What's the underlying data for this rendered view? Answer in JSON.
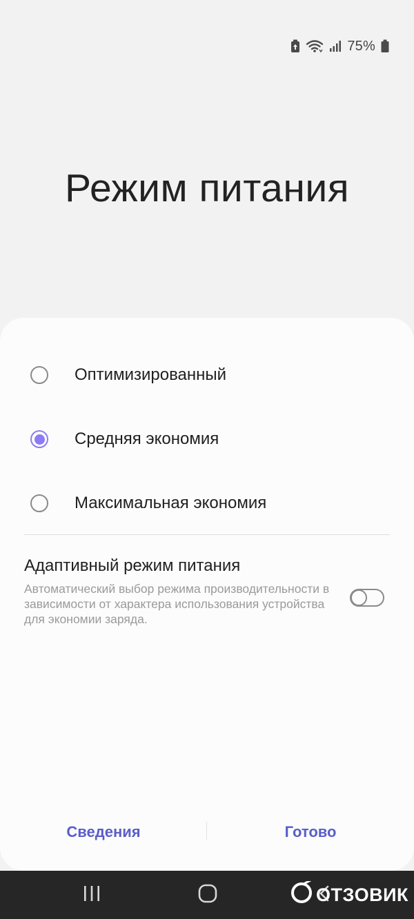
{
  "status_bar": {
    "battery_percent": "75%",
    "icons": [
      "battery-saver-icon",
      "wifi-icon",
      "signal-icon",
      "battery-icon"
    ]
  },
  "title": "Режим питания",
  "options": [
    {
      "label": "Оптимизированный",
      "selected": false
    },
    {
      "label": "Средняя экономия",
      "selected": true
    },
    {
      "label": "Максимальная экономия",
      "selected": false
    }
  ],
  "adaptive": {
    "title": "Адаптивный режим питания",
    "description": "Автоматический выбор режима производительности в зависимости от характера использования устройства для экономии заряда.",
    "enabled": false
  },
  "buttons": {
    "details": "Сведения",
    "done": "Готово"
  },
  "nav_bar": {
    "icons": [
      "recents-icon",
      "home-icon",
      "back-icon"
    ]
  },
  "watermark": {
    "text": "ОТЗОВИК"
  },
  "colors": {
    "accent": "#8c7cf4",
    "button_text": "#5a5ec9",
    "sheet_bg": "#fcfcfc",
    "page_bg": "#f2f2f2",
    "nav_bg": "#262626"
  }
}
